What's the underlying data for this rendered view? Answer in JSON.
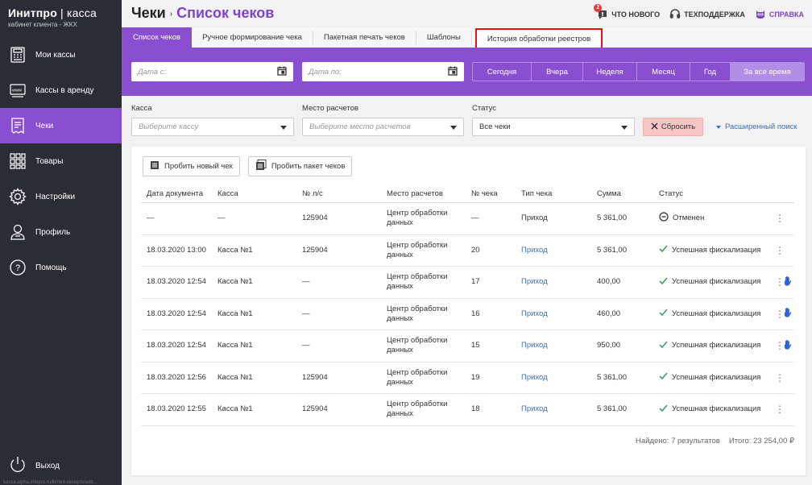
{
  "brand": {
    "title_bold": "Инитпро",
    "title_sep": " | ",
    "title_rest": "касса",
    "subtitle": "кабинет клиента - ЖКХ"
  },
  "sidebar": {
    "items": [
      {
        "label": "Мои кассы",
        "icon": "cash-register-icon"
      },
      {
        "label": "Кассы в аренду",
        "icon": "www-register-icon"
      },
      {
        "label": "Чеки",
        "icon": "receipt-icon",
        "active": true
      },
      {
        "label": "Товары",
        "icon": "grid-icon"
      },
      {
        "label": "Настройки",
        "icon": "gear-icon"
      },
      {
        "label": "Профиль",
        "icon": "user-icon"
      },
      {
        "label": "Помощь",
        "icon": "question-icon"
      }
    ],
    "logout": "Выход",
    "status_url": "kassa.alpha.intepro.ru/lk/rent-receipts/edit..."
  },
  "header": {
    "crumb1": "Чеки",
    "crumb2": "Список чеков",
    "news": "ЧТО НОВОГО",
    "news_count": "2",
    "support": "ТЕХПОДДЕРЖКА",
    "help": "СПРАВКА"
  },
  "tabs": [
    "Список чеков",
    "Ручное формирование чека",
    "Пакетная печать чеков",
    "Шаблоны",
    "История обработки реестров"
  ],
  "datebar": {
    "from_placeholder": "Дата с:",
    "to_placeholder": "Дата по:",
    "periods": [
      "Сегодня",
      "Вчера",
      "Неделя",
      "Месяц",
      "Год",
      "За все время"
    ],
    "selected": "За все время"
  },
  "filters": {
    "kassa_label": "Касса",
    "kassa_placeholder": "Выберите кассу",
    "place_label": "Место расчетов",
    "place_placeholder": "Выберите место расчетов",
    "status_label": "Статус",
    "status_value": "Все чеки",
    "reset": "Сбросить",
    "advanced": "Расширенный поиск"
  },
  "actions": {
    "new_check": "Пробить новый чек",
    "batch": "Пробить пакет чеков"
  },
  "table": {
    "headers": [
      "Дата документа",
      "Касса",
      "№ л/с",
      "Место расчетов",
      "№ чека",
      "Тип чека",
      "Сумма",
      "Статус"
    ],
    "rows": [
      {
        "date": "—",
        "kassa": "—",
        "ls": "125904",
        "place": "Центр обработки данных",
        "num": "—",
        "type": "Приход",
        "type_link": false,
        "sum": "5 361,00",
        "status": "Отменен",
        "status_icon": "minus-circle-icon",
        "hand": false
      },
      {
        "date": "18.03.2020 13:00",
        "kassa": "Касса №1",
        "ls": "125904",
        "place": "Центр обработки данных",
        "num": "20",
        "type": "Приход",
        "type_link": true,
        "sum": "5 361,00",
        "status": "Успешная фискализация",
        "status_icon": "check-icon",
        "hand": false
      },
      {
        "date": "18.03.2020 12:54",
        "kassa": "Касса №1",
        "ls": "—",
        "place": "Центр обработки данных",
        "num": "17",
        "type": "Приход",
        "type_link": true,
        "sum": "400,00",
        "status": "Успешная фискализация",
        "status_icon": "check-icon",
        "hand": true
      },
      {
        "date": "18.03.2020 12:54",
        "kassa": "Касса №1",
        "ls": "—",
        "place": "Центр обработки данных",
        "num": "16",
        "type": "Приход",
        "type_link": true,
        "sum": "460,00",
        "status": "Успешная фискализация",
        "status_icon": "check-icon",
        "hand": true
      },
      {
        "date": "18.03.2020 12:54",
        "kassa": "Касса №1",
        "ls": "—",
        "place": "Центр обработки данных",
        "num": "15",
        "type": "Приход",
        "type_link": true,
        "sum": "950,00",
        "status": "Успешная фискализация",
        "status_icon": "check-icon",
        "hand": true
      },
      {
        "date": "18.03.2020 12:56",
        "kassa": "Касса №1",
        "ls": "125904",
        "place": "Центр обработки данных",
        "num": "19",
        "type": "Приход",
        "type_link": true,
        "sum": "5 361,00",
        "status": "Успешная фискализация",
        "status_icon": "check-icon",
        "hand": false
      },
      {
        "date": "18.03.2020 12:55",
        "kassa": "Касса №1",
        "ls": "125904",
        "place": "Центр обработки данных",
        "num": "18",
        "type": "Приход",
        "type_link": true,
        "sum": "5 361,00",
        "status": "Успешная фискализация",
        "status_icon": "check-icon",
        "hand": false
      }
    ]
  },
  "footer": {
    "found": "Найдено: 7 результатов",
    "total": "Итого: 23 254,00 ₽"
  },
  "colors": {
    "accent": "#8a4fd1",
    "sidebar": "#2b2d36",
    "link": "#3b6fb6",
    "success": "#2e9e5b",
    "reset": "#f6c6c6"
  }
}
